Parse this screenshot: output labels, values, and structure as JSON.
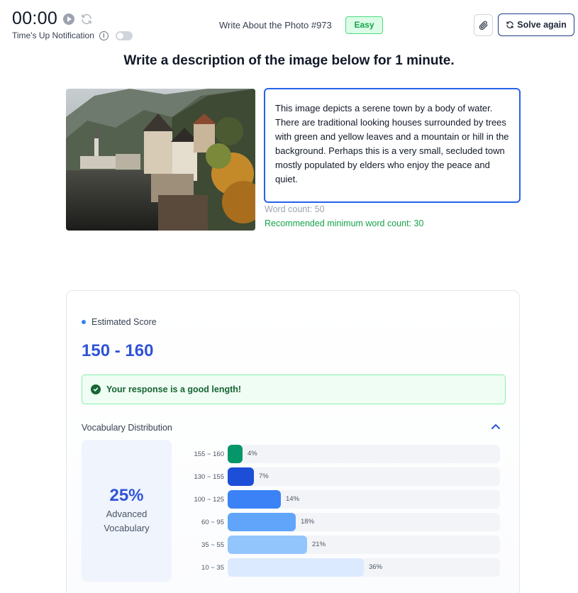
{
  "header": {
    "timer": "00:00",
    "notification_label": "Time's Up Notification",
    "task_title": "Write About the Photo #973",
    "difficulty": "Easy",
    "solve_again_label": "Solve again"
  },
  "instruction": "Write a description of the image below for 1 minute.",
  "response": {
    "text": "This image depicts a serene town by a body of water. There are traditional looking houses surrounded by trees with green and yellow leaves and a mountain or hill in the background. Perhaps this is a very small, secluded town mostly populated by elders who enjoy the peace and quiet.",
    "word_count": "Word count: 50",
    "recommended": "Recommended minimum word count: 30"
  },
  "score": {
    "label": "Estimated Score",
    "value": "150 - 160",
    "length_message": "Your response is a good length!"
  },
  "vocabulary": {
    "title": "Vocabulary Distribution",
    "advanced_percent": "25%",
    "advanced_line1": "Advanced",
    "advanced_line2": "Vocabulary",
    "distribution": [
      {
        "range": "155 ~ 160",
        "percent": 4,
        "label": "4%",
        "color": "#059669"
      },
      {
        "range": "130 ~ 155",
        "percent": 7,
        "label": "7%",
        "color": "#1d4ed8"
      },
      {
        "range": "100 ~ 125",
        "percent": 14,
        "label": "14%",
        "color": "#3b82f6"
      },
      {
        "range": "60 ~ 95",
        "percent": 18,
        "label": "18%",
        "color": "#60a5fa"
      },
      {
        "range": "35 ~ 55",
        "percent": 21,
        "label": "21%",
        "color": "#93c5fd"
      },
      {
        "range": "10 ~ 35",
        "percent": 36,
        "label": "36%",
        "color": "#dbeafe"
      }
    ]
  }
}
